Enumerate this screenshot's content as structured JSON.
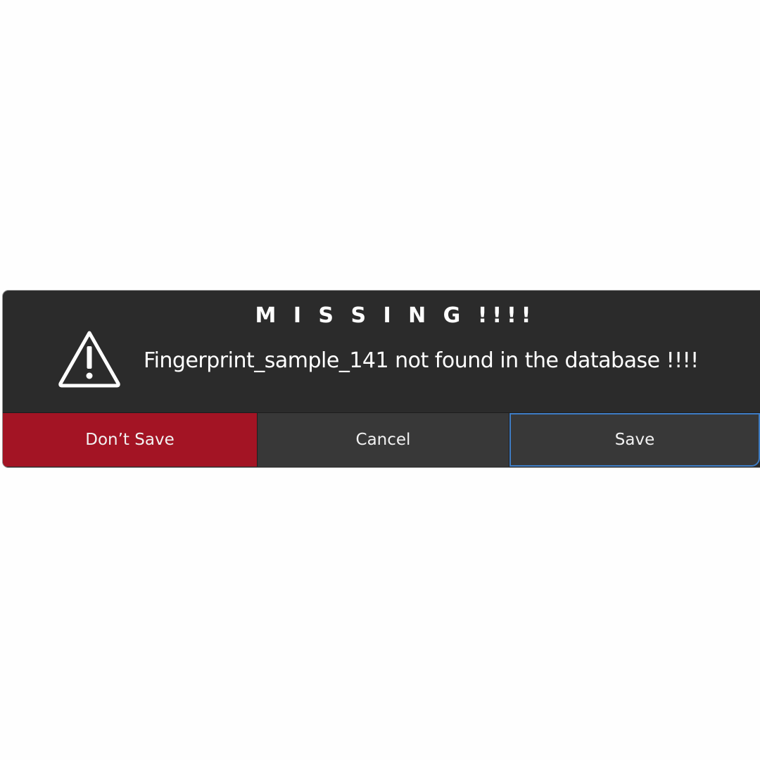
{
  "dialog": {
    "title": "M I S S I N G !!!!",
    "message": "Fingerprint_sample_141 not found in the database !!!!",
    "icon": "warning-triangle-icon"
  },
  "buttons": {
    "dont_save_label": "Don’t Save",
    "cancel_label": "Cancel",
    "save_label": "Save"
  },
  "colors": {
    "dialog_background": "#2b2b2b",
    "destructive_button": "#a31424",
    "button_background": "#383838",
    "focus_ring": "#3e7cc4",
    "text": "#ffffff"
  }
}
